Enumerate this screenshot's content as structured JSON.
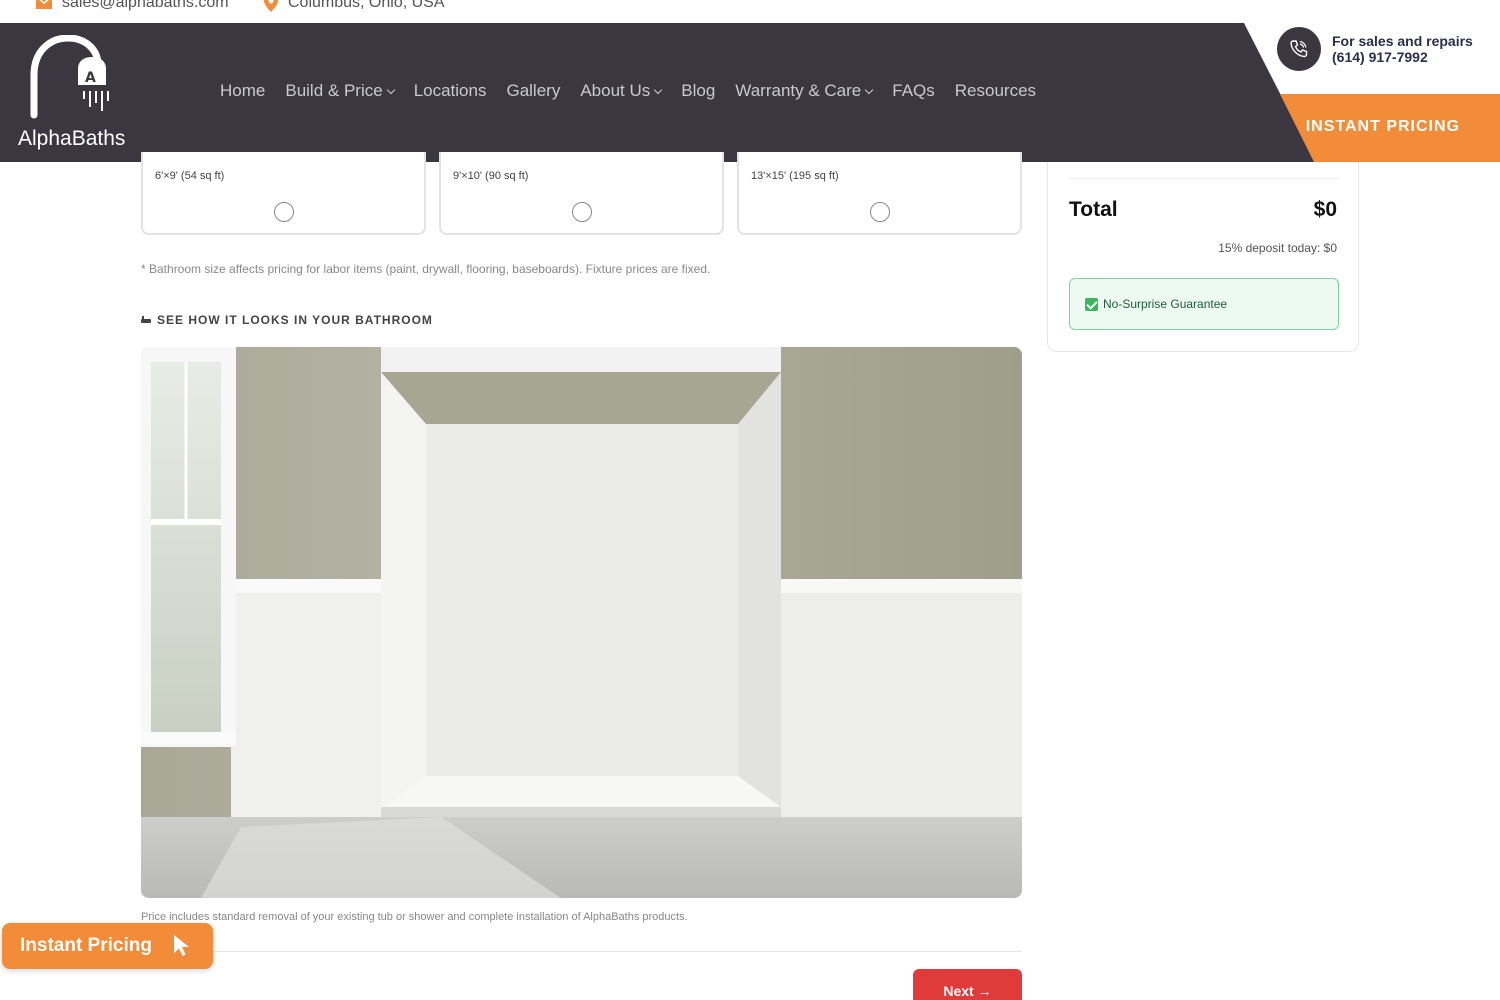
{
  "topbar": {
    "email": "sales@alphabaths.com",
    "location": "Columbus, Ohio, USA"
  },
  "logo": {
    "text": "AlphaBaths"
  },
  "nav": {
    "items": [
      {
        "label": "Home"
      },
      {
        "label": "Build & Price"
      },
      {
        "label": "Locations"
      },
      {
        "label": "Gallery"
      },
      {
        "label": "About Us"
      },
      {
        "label": "Blog"
      },
      {
        "label": "Warranty & Care"
      },
      {
        "label": "FAQs"
      },
      {
        "label": "Resources"
      }
    ]
  },
  "contact": {
    "line1": "For sales and repairs",
    "line2": "(614) 917-7992"
  },
  "header": {
    "instant_pricing": "INSTANT PRICING"
  },
  "sizes": [
    {
      "dims": "6'×9' (54 sq ft)"
    },
    {
      "dims": "9'×10' (90 sq ft)"
    },
    {
      "dims": "13'×15' (195 sq ft)"
    }
  ],
  "note": "* Bathroom size affects pricing for labor items (paint, drywall, flooring, baseboards). Fixture prices are fixed.",
  "preview": {
    "heading": "SEE HOW IT LOOKS IN YOUR BATHROOM",
    "caption": "Price includes standard removal of your existing tub or shower and complete installation of AlphaBaths products."
  },
  "actions": {
    "next": "Next →"
  },
  "floating": {
    "label": "Instant Pricing"
  },
  "summary": {
    "total_label": "Total",
    "total_value": "$0",
    "deposit": "15% deposit today: $0",
    "guarantee": "No-Surprise Guarantee"
  },
  "colors": {
    "header_dark": "#3a3741",
    "accent_orange": "#f28c38",
    "next_red": "#e03b3b",
    "guarantee_green": "#3bb55e"
  }
}
